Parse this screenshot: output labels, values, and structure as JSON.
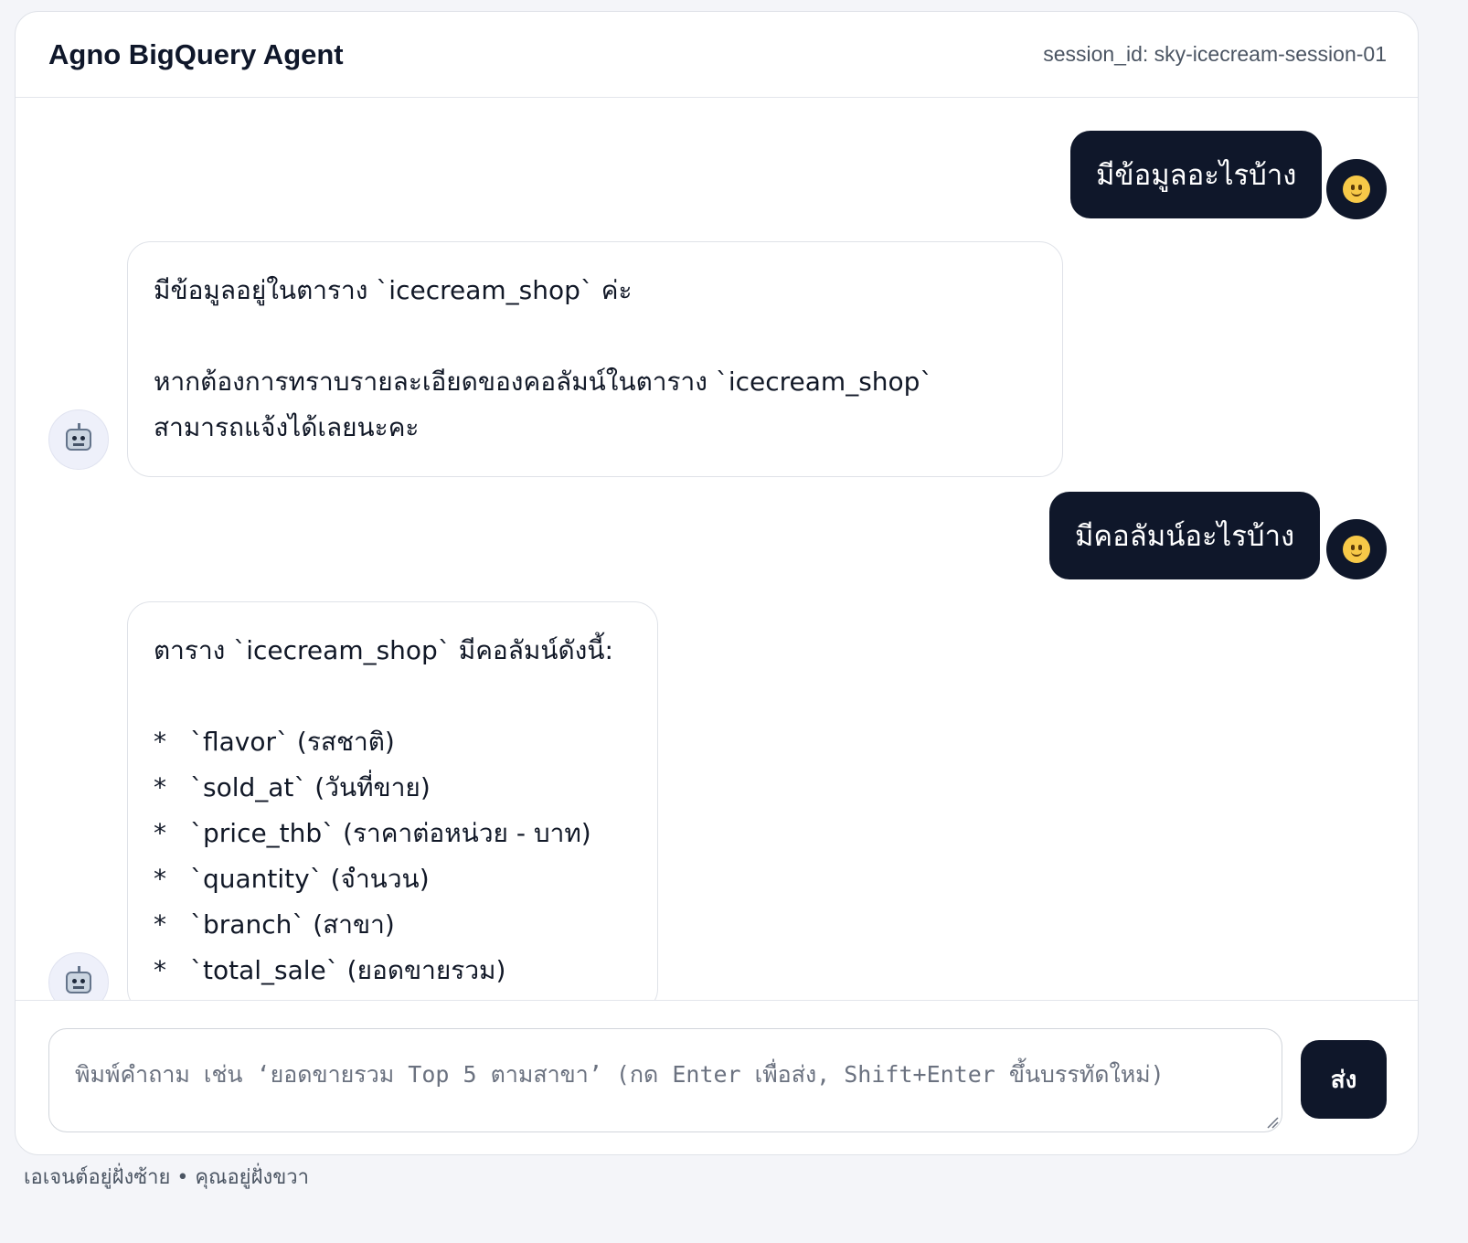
{
  "header": {
    "title": "Agno BigQuery Agent",
    "session_label": "session_id: sky-icecream-session-01"
  },
  "messages": [
    {
      "role": "user",
      "text": "มีข้อมูลอะไรบ้าง",
      "avatar_icon": "smiley-face-icon"
    },
    {
      "role": "agent",
      "avatar_icon": "robot-icon",
      "lines": [
        "มีข้อมูลอยู่ในตาราง `icecream_shop` ค่ะ",
        "หากต้องการทราบรายละเอียดของคอลัมน์ในตาราง `icecream_shop`",
        "สามารถแจ้งได้เลยนะคะ"
      ]
    },
    {
      "role": "user",
      "text": "มีคอลัมน์อะไรบ้าง",
      "avatar_icon": "smiley-face-icon"
    },
    {
      "role": "agent",
      "avatar_icon": "robot-icon",
      "intro": "ตาราง `icecream_shop` มีคอลัมน์ดังนี้:",
      "bullet": "*",
      "items": [
        "`flavor` (รสชาติ)",
        "`sold_at` (วันที่ขาย)",
        "`price_thb` (ราคาต่อหน่วย - บาท)",
        "`quantity` (จำนวน)",
        "`branch` (สาขา)",
        "`total_sale` (ยอดขายรวม)"
      ]
    }
  ],
  "composer": {
    "placeholder": "พิมพ์คำถาม เช่น ‘ยอดขายรวม Top 5 ตามสาขา’ (กด Enter เพื่อส่ง, Shift+Enter ขึ้นบรรทัดใหม่)",
    "value": "",
    "send_label": "ส่ง"
  },
  "footer": {
    "note": "เอเจนต์อยู่ฝั่งซ้าย • คุณอยู่ฝั่งขวา"
  },
  "colors": {
    "user_bubble": "#0f172a",
    "page_bg": "#f4f5f9",
    "card_bg": "#ffffff"
  }
}
